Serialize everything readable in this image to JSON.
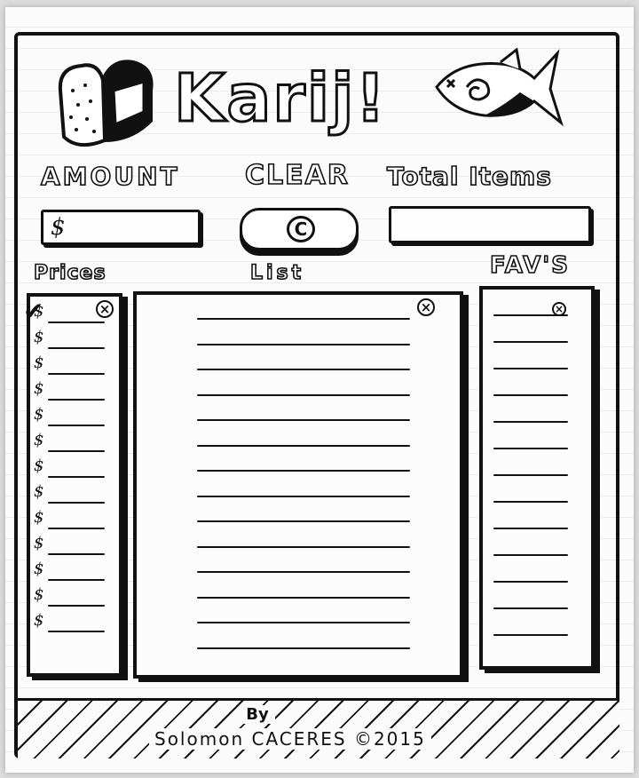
{
  "app": {
    "title": "Karij!"
  },
  "header": {
    "logo_left": "bread-icon",
    "logo_right": "fish-icon"
  },
  "labels": {
    "amount": "AMOUNT",
    "clear": "CLEAR",
    "total_items": "Total Items",
    "prices": "Prices",
    "list": "List",
    "favs": "FAV'S"
  },
  "amount_field": {
    "currency": "$",
    "value": ""
  },
  "total_items_field": {
    "value": ""
  },
  "clear_button": {
    "glyph": "C"
  },
  "prices": {
    "currency": "$",
    "rows": [
      "",
      "",
      "",
      "",
      "",
      "",
      "",
      "",
      "",
      "",
      "",
      "",
      ""
    ]
  },
  "list": {
    "rows": [
      "",
      "",
      "",
      "",
      "",
      "",
      "",
      "",
      "",
      "",
      "",
      "",
      "",
      ""
    ]
  },
  "favs": {
    "rows": [
      "",
      "",
      "",
      "",
      "",
      "",
      "",
      "",
      "",
      "",
      "",
      "",
      ""
    ]
  },
  "footer": {
    "by": "By",
    "credit": "Solomon CACERES ©2015"
  }
}
